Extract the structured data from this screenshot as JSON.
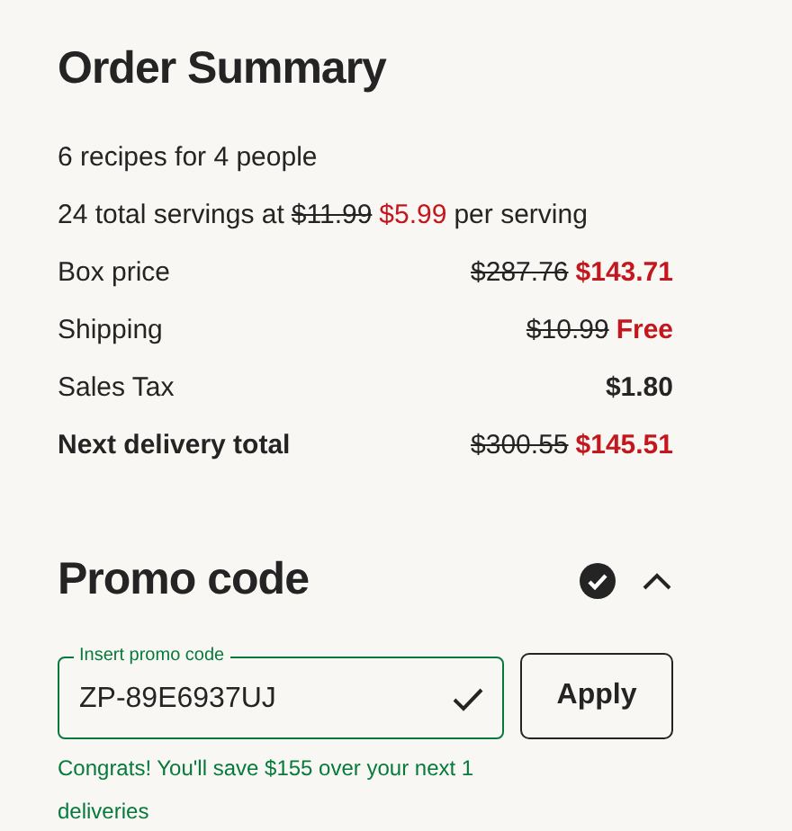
{
  "title": "Order Summary",
  "recipes_line": "6 recipes for 4 people",
  "servings_line": [
    {
      "kind": "plain",
      "text": "24 total servings at"
    },
    {
      "kind": "old",
      "text": "$11.99"
    },
    {
      "kind": "sale",
      "text": "$5.99"
    },
    {
      "kind": "plain",
      "text": "per serving"
    }
  ],
  "rows": [
    {
      "label": "Box price",
      "bold": false,
      "old_price": "$287.76",
      "price": "$143.71",
      "kind": "sale"
    },
    {
      "label": "Shipping",
      "bold": false,
      "old_price": "$10.99",
      "price": "Free",
      "kind": "sale"
    },
    {
      "label": "Sales Tax",
      "bold": false,
      "price": "$1.80",
      "kind": "plain"
    },
    {
      "label": "Next delivery total",
      "bold": true,
      "old_price": "$300.55",
      "price": "$145.51",
      "kind": "sale"
    }
  ],
  "promo": {
    "title": "Promo code",
    "applied": true,
    "expanded": true,
    "field": {
      "label": "Insert promo code",
      "value": "ZP-89E6937UJ",
      "valid": true
    },
    "button": "Apply",
    "message": "Congrats! You'll save $155 over your next 1 deliveries"
  }
}
